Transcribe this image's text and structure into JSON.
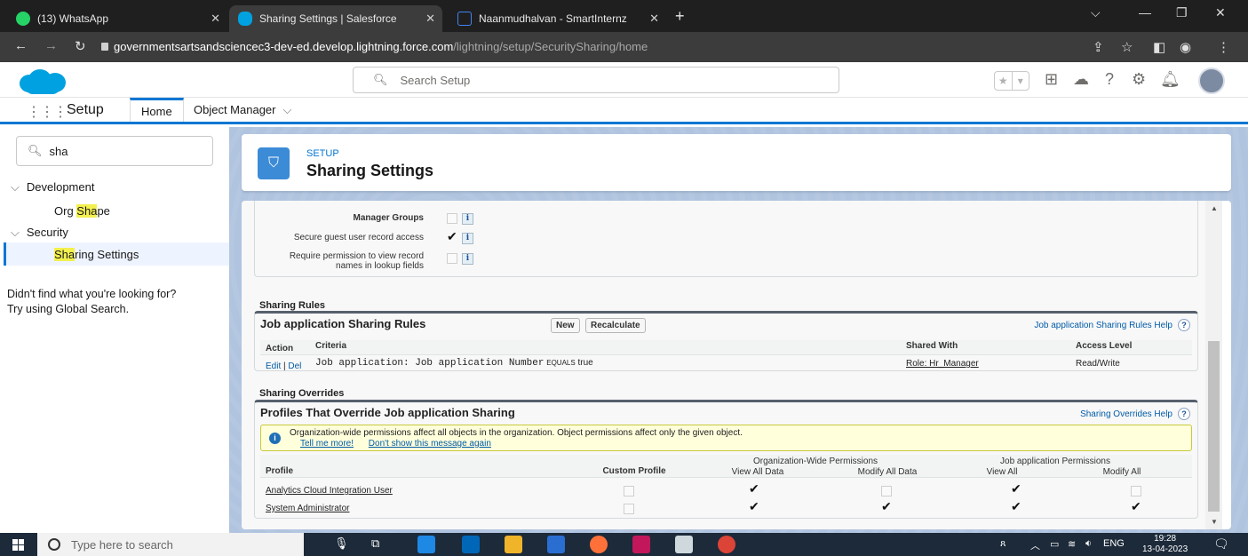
{
  "browser": {
    "tabs": [
      {
        "title": "(13) WhatsApp",
        "badge": "13",
        "favicon_color": "#25d366"
      },
      {
        "title": "Sharing Settings | Salesforce",
        "favicon_color": "#00a1e0"
      },
      {
        "title": "Naanmudhalvan - SmartInternz",
        "favicon_color": "#4285f4"
      }
    ],
    "url_host": "governmentsartsandsciencec3-dev-ed.develop.lightning.force.com",
    "url_path": "/lightning/setup/SecuritySharing/home"
  },
  "header": {
    "search_placeholder": "Search Setup"
  },
  "appnav": {
    "app_name": "Setup",
    "tabs": [
      {
        "label": "Home"
      },
      {
        "label": "Object Manager"
      }
    ]
  },
  "sidebar": {
    "quickfind_value": "sha",
    "development": "Development",
    "org_shape_pre": "Org ",
    "org_shape_hl": "Sha",
    "org_shape_post": "pe",
    "security": "Security",
    "sharing_hl": "Sha",
    "sharing_post": "ring Settings",
    "not_found_1": "Didn't find what you're looking for?",
    "not_found_2": "Try using Global Search."
  },
  "page": {
    "eyebrow": "SETUP",
    "title": "Sharing Settings"
  },
  "owd": {
    "manager_groups": "Manager Groups",
    "secure_guest": "Secure guest user record access",
    "require_perm_1": "Require permission to view record",
    "require_perm_2": "names in lookup fields",
    "info": "i"
  },
  "sharing_rules": {
    "section": "Sharing Rules",
    "title": "Job application Sharing Rules",
    "new_btn": "New",
    "recalc_btn": "Recalculate",
    "help": "Job application Sharing Rules Help",
    "columns": [
      "Action",
      "Criteria",
      "Shared With",
      "Access Level"
    ],
    "row": {
      "edit": "Edit",
      "sep": " | ",
      "del": "Del",
      "criteria_field": "Job application: Job application Number",
      "criteria_op": "EQUALS",
      "criteria_val": "true",
      "shared_with": "Role: Hr_Manager",
      "access": "Read/Write"
    }
  },
  "overrides": {
    "section": "Sharing Overrides",
    "title": "Profiles That Override Job application Sharing",
    "help": "Sharing Overrides Help",
    "msg": "Organization-wide permissions affect all objects in the organization. Object permissions affect only the given object.",
    "tell_more": "Tell me more!",
    "dont_show": "Don't show this message again",
    "col_profile": "Profile",
    "col_custom": "Custom Profile",
    "group_org": "Organization-Wide Permissions",
    "group_obj": "Job application Permissions",
    "col_view_all_data": "View All Data",
    "col_modify_all_data": "Modify All Data",
    "col_view_all": "View All",
    "col_modify_all": "Modify All",
    "rows": [
      {
        "profile": "Analytics Cloud Integration User",
        "custom": false,
        "view_all_data": true,
        "modify_all_data": false,
        "view_all": true,
        "modify_all": false
      },
      {
        "profile": "System Administrator",
        "custom": false,
        "view_all_data": true,
        "modify_all_data": true,
        "view_all": true,
        "modify_all": true
      }
    ]
  },
  "taskbar": {
    "search_placeholder": "Type here to search",
    "lang": "ENG",
    "time": "19:28",
    "date": "13-04-2023"
  },
  "colors": {
    "brand": "#0176d3",
    "sf_cloud": "#00a1e0"
  }
}
